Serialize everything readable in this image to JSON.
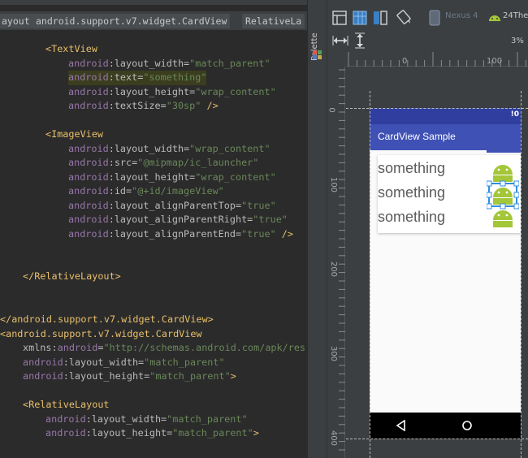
{
  "editor": {
    "breadcrumbs": [
      "ayout",
      "android.support.v7.widget.CardView",
      "RelativeLa"
    ],
    "lines": [
      {
        "parts": [
          [
            "tag",
            "<TextView"
          ]
        ]
      },
      {
        "parts": [
          [
            "ns",
            "android"
          ],
          [
            "attr",
            ":layout_width="
          ],
          [
            "val",
            "\"match_parent\""
          ]
        ]
      },
      {
        "parts": [
          [
            "ns",
            "android"
          ],
          [
            "attr",
            ":text="
          ],
          [
            "val",
            "\"something\""
          ]
        ]
      },
      {
        "parts": [
          [
            "ns",
            "android"
          ],
          [
            "attr",
            ":layout_height="
          ],
          [
            "val",
            "\"wrap_content\""
          ]
        ]
      },
      {
        "parts": [
          [
            "ns",
            "android"
          ],
          [
            "attr",
            ":textSize="
          ],
          [
            "val",
            "\"30sp\""
          ],
          [
            "punc",
            " />"
          ]
        ]
      },
      {
        "parts": [
          [
            "tag",
            "<ImageView"
          ]
        ]
      },
      {
        "parts": [
          [
            "ns",
            "android"
          ],
          [
            "attr",
            ":layout_width="
          ],
          [
            "val",
            "\"wrap_content\""
          ]
        ]
      },
      {
        "parts": [
          [
            "ns",
            "android"
          ],
          [
            "attr",
            ":src="
          ],
          [
            "val",
            "\"@mipmap/ic_launcher\""
          ]
        ]
      },
      {
        "parts": [
          [
            "ns",
            "android"
          ],
          [
            "attr",
            ":layout_height="
          ],
          [
            "val",
            "\"wrap_content\""
          ]
        ]
      },
      {
        "parts": [
          [
            "ns",
            "android"
          ],
          [
            "attr",
            ":id="
          ],
          [
            "val",
            "\"@+id/imageView\""
          ]
        ]
      },
      {
        "parts": [
          [
            "ns",
            "android"
          ],
          [
            "attr",
            ":layout_alignParentTop="
          ],
          [
            "val",
            "\"true\""
          ]
        ]
      },
      {
        "parts": [
          [
            "ns",
            "android"
          ],
          [
            "attr",
            ":layout_alignParentRight="
          ],
          [
            "val",
            "\"true\""
          ]
        ]
      },
      {
        "parts": [
          [
            "ns",
            "android"
          ],
          [
            "attr",
            ":layout_alignParentEnd="
          ],
          [
            "val",
            "\"true\""
          ],
          [
            "punc",
            " />"
          ]
        ]
      },
      {
        "parts": [
          [
            "tag",
            "</RelativeLayout>"
          ]
        ]
      },
      {
        "parts": [
          [
            "tag",
            "</android.support.v7.widget.CardView>"
          ]
        ]
      },
      {
        "parts": [
          [
            "tag",
            "<android.support.v7.widget.CardView"
          ]
        ]
      },
      {
        "parts": [
          [
            "attr",
            "xmlns:"
          ],
          [
            "ns",
            "android"
          ],
          [
            "attr",
            "="
          ],
          [
            "val",
            "\"http://schemas.android.com/apk/res"
          ]
        ]
      },
      {
        "parts": [
          [
            "ns",
            "android"
          ],
          [
            "attr",
            ":layout_width="
          ],
          [
            "val",
            "\"match_parent\""
          ]
        ]
      },
      {
        "parts": [
          [
            "ns",
            "android"
          ],
          [
            "attr",
            ":layout_height="
          ],
          [
            "val",
            "\"match_parent\""
          ],
          [
            "punc",
            ">"
          ]
        ]
      },
      {
        "parts": [
          [
            "tag",
            "<RelativeLayout"
          ]
        ]
      },
      {
        "parts": [
          [
            "ns",
            "android"
          ],
          [
            "attr",
            ":layout_width="
          ],
          [
            "val",
            "\"match_parent\""
          ]
        ]
      },
      {
        "parts": [
          [
            "ns",
            "android"
          ],
          [
            "attr",
            ":layout_height="
          ],
          [
            "val",
            "\"match_parent\""
          ],
          [
            "punc",
            ">"
          ]
        ]
      }
    ]
  },
  "preview": {
    "palette_label": "Palette",
    "device_label": "Nexus 4",
    "api_label": "24The",
    "zoom_label": "3%",
    "ruler_top_ticks": [
      "0",
      "100"
    ],
    "ruler_left_ticks": [
      "0",
      "100",
      "200",
      "300",
      "400"
    ],
    "app_title": "CardView Sample",
    "card_texts": [
      "something",
      "something",
      "something"
    ],
    "colors": {
      "primary": "#3f51b5",
      "primary_dark": "#303f9f",
      "android_green": "#a4c639"
    }
  }
}
